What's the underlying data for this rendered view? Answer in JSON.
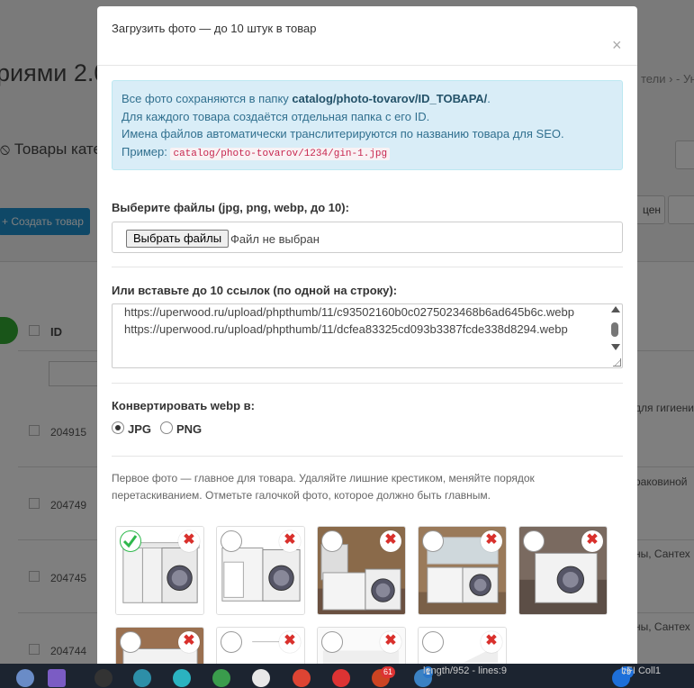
{
  "background": {
    "page_title": "риями 2.0",
    "breadcrumb": "тели › - Ун",
    "subtitle": "Товары кате",
    "create_button": "Создать товар",
    "button_right": "цен",
    "column_id": "ID",
    "rows": [
      {
        "id": "204915",
        "right": "для гигиени"
      },
      {
        "id": "204749",
        "right": "раковиной"
      },
      {
        "id": "204745",
        "right": "ны, Сантех"
      },
      {
        "id": "204744",
        "right": "ны, Сантех"
      }
    ]
  },
  "taskbar": {
    "text1": "length/952 - lines:9",
    "text2": "LFI   Coll1",
    "badge1": "1",
    "badge2": "79",
    "badge3": "61"
  },
  "modal": {
    "title": "Загрузить фото — до 10 штук в товар",
    "close": "×",
    "info": {
      "line1_prefix": "Все фото сохраняются в папку ",
      "line1_path": "catalog/photo-tovarov/ID_TOВАРА/",
      "line1_suffix": ".",
      "line2": "Для каждого товара создаётся отдельная папка с его ID.",
      "line3": "Имена файлов автоматически транслитерируются по названию товара для SEO.",
      "example_label": "Пример:",
      "example_code": "catalog/photo-tovarov/1234/gin-1.jpg"
    },
    "files_label": "Выберите файлы (jpg, png, webp, до 10):",
    "file_button": "Выбрать файлы",
    "file_status": "Файл не выбран",
    "urls_label": "Или вставьте до 10 ссылок (по одной на строку):",
    "urls": [
      "https://uperwood.ru/upload/phpthumb/11/c93502160b0c0275023468b6ad645b6c.webp",
      "https://uperwood.ru/upload/phpthumb/11/dcfea83325cd093b3387fcde338d8294.webp"
    ],
    "convert_label": "Конвертировать webp в:",
    "convert_options": [
      "JPG",
      "PNG"
    ],
    "convert_selected": "JPG",
    "hint": "Первое фото — главное для товара. Удаляйте лишние крестиком, меняйте порядок перетаскиванием. Отметьте галочкой фото, которое должно быть главным.",
    "delete_glyph": "✖",
    "check_glyph": "✔",
    "photos_count": 9,
    "main_photo_index": 0
  }
}
